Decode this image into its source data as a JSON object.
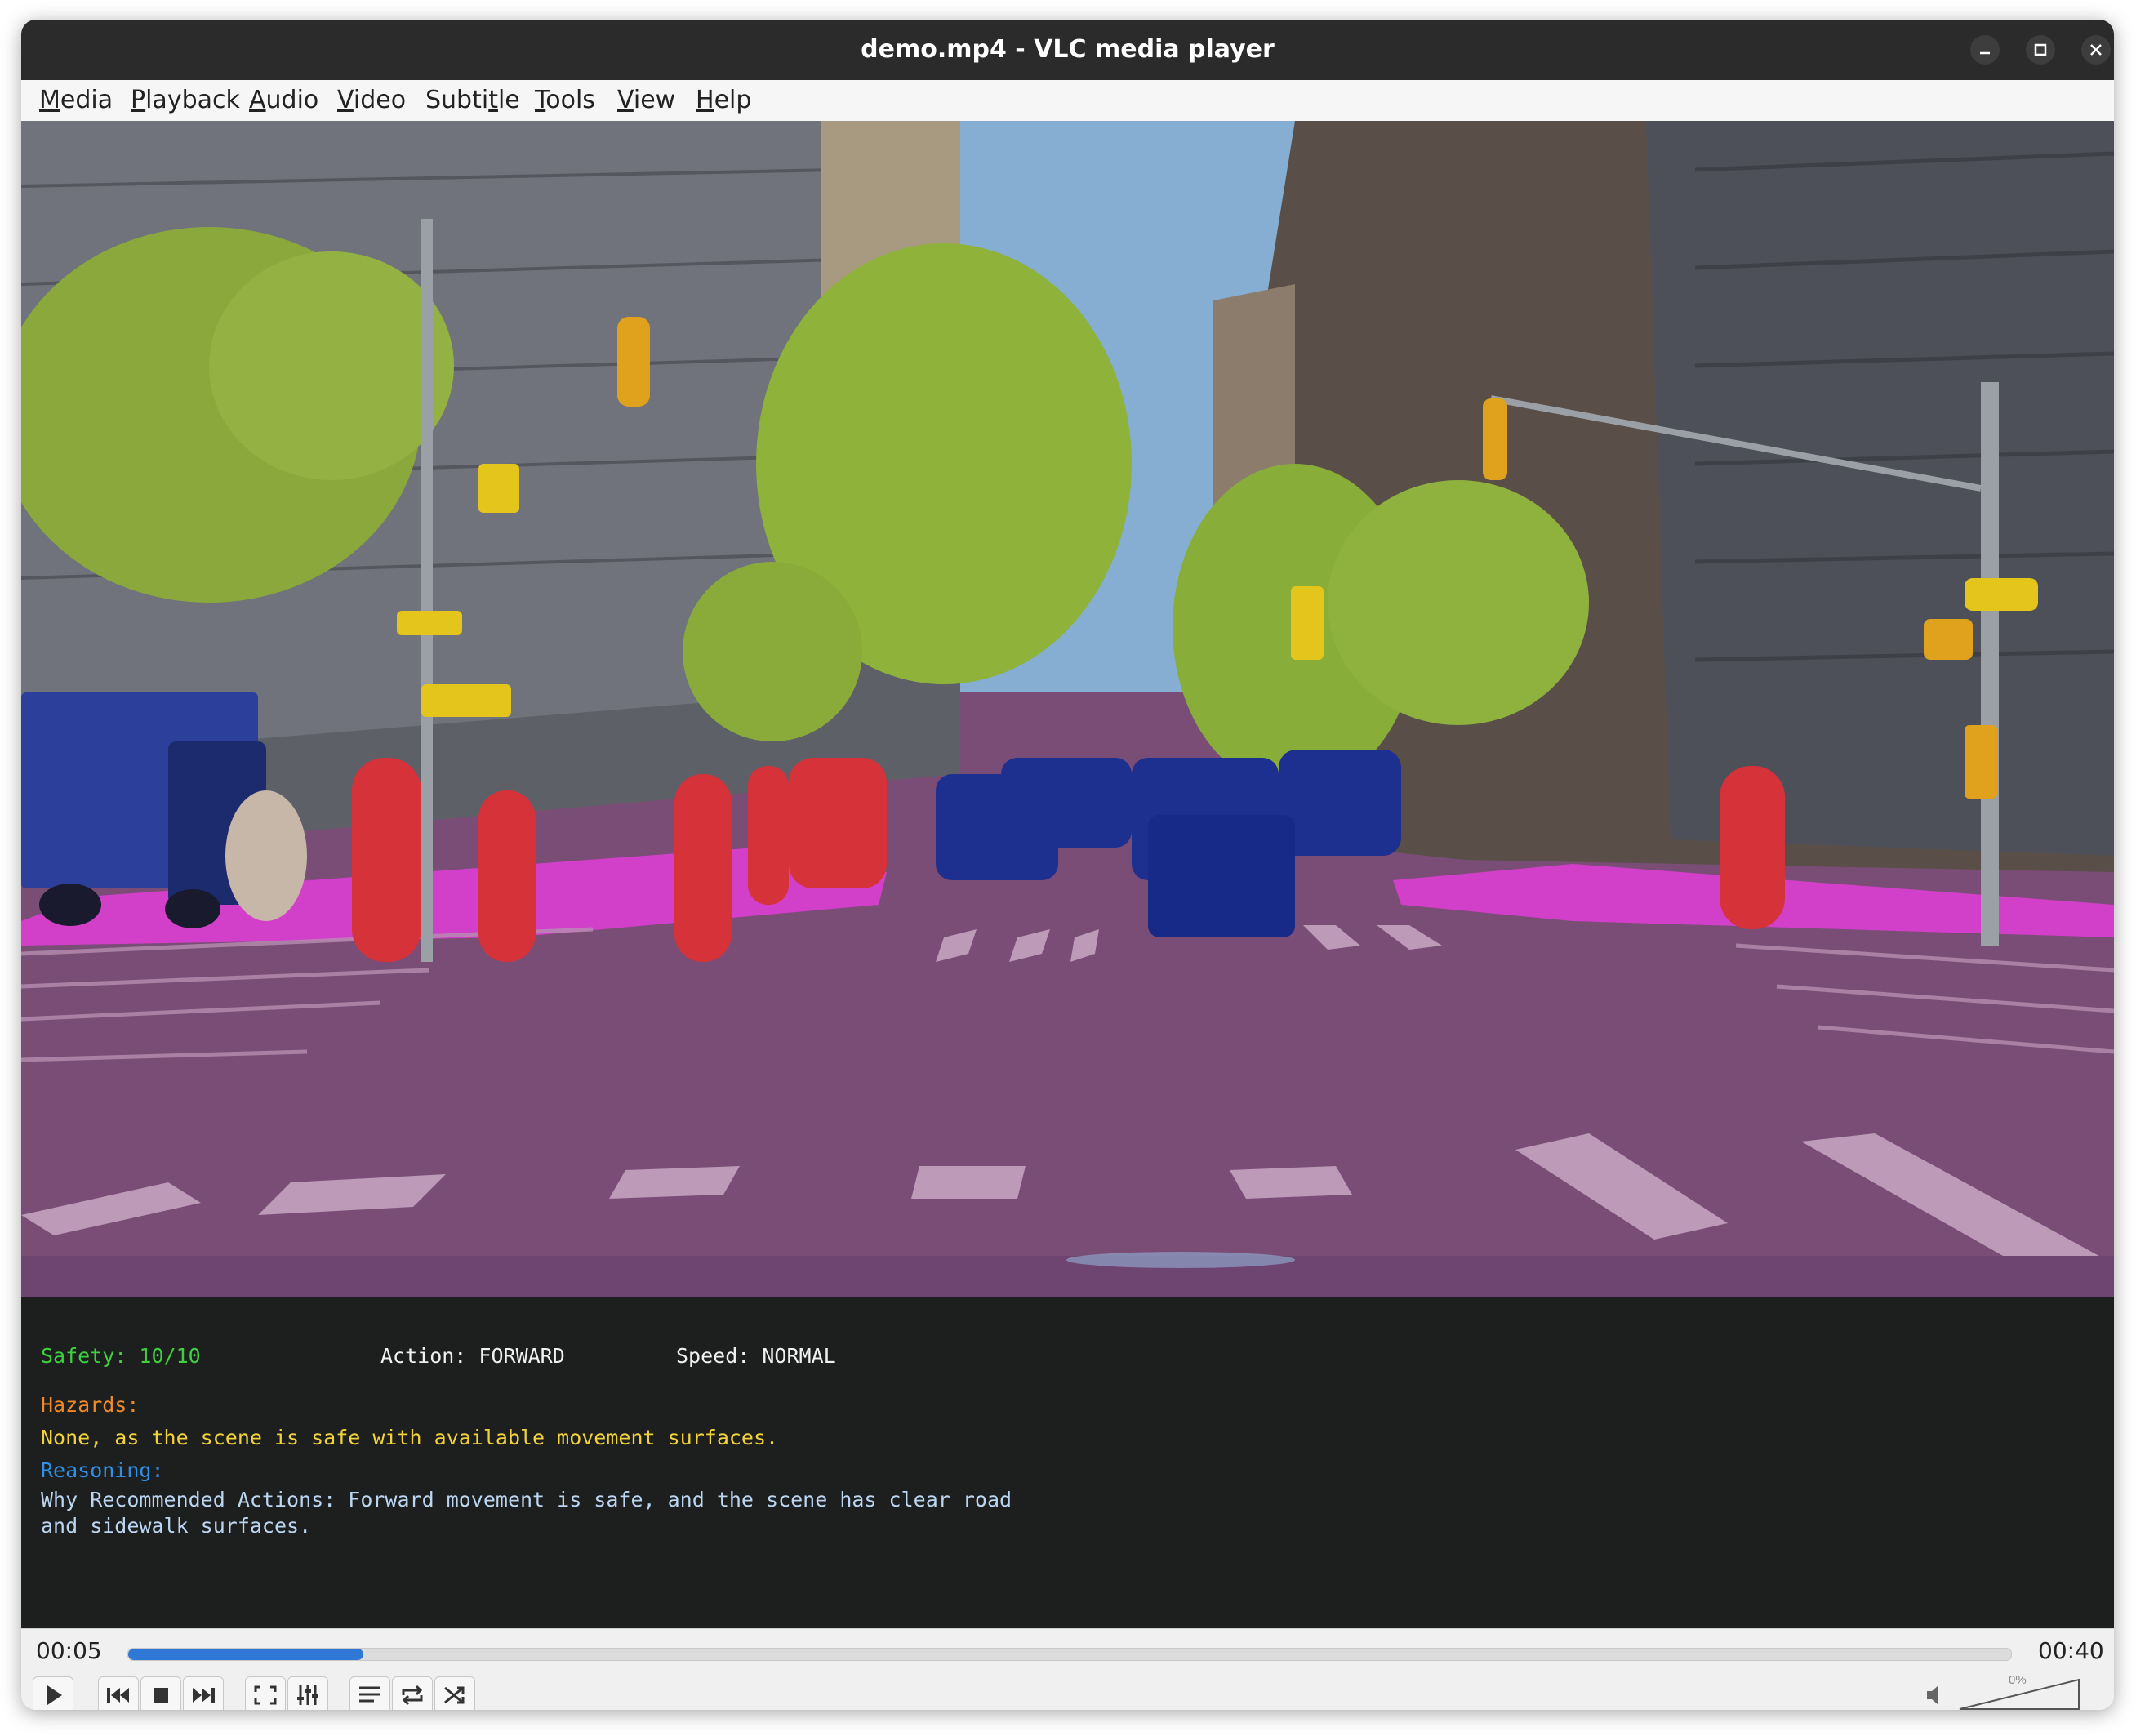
{
  "window": {
    "title": "demo.mp4 - VLC media player"
  },
  "menu": [
    {
      "label": "Media",
      "underline": "M",
      "rest": "edia"
    },
    {
      "label": "Playback",
      "underline": "P",
      "rest": "layback"
    },
    {
      "label": "Audio",
      "underline": "A",
      "rest": "udio"
    },
    {
      "label": "Video",
      "underline": "V",
      "rest": "ideo"
    },
    {
      "label": "Subtitle",
      "pre": "Subti",
      "underline": "t",
      "rest": "le"
    },
    {
      "label": "Tools",
      "underline": "T",
      "rest": "ools"
    },
    {
      "label": "View",
      "underline": "V",
      "rest": "iew"
    },
    {
      "label": "Help",
      "underline": "H",
      "rest": "elp"
    }
  ],
  "overlay": {
    "safety": "Safety: 10/10",
    "action": "Action: FORWARD",
    "speed": "Speed: NORMAL",
    "hazards_label": "Hazards:",
    "hazards_text": "None, as the scene is safe with available movement surfaces.",
    "reasoning_label": "Reasoning:",
    "reasoning_line1": "Why Recommended Actions: Forward movement is safe, and the scene has clear road",
    "reasoning_line2": "and sidewalk surfaces.",
    "colors": {
      "safety": "#3fcf3f",
      "hazards_label": "#f08a2a",
      "hazards_text": "#f2d23c",
      "reasoning_label": "#2f8fe8",
      "reasoning_text": "#bcd6f2",
      "neutral": "#f0f0f0"
    }
  },
  "player": {
    "elapsed": "00:05",
    "total": "00:40",
    "progress_fraction": 0.125,
    "volume_label": "0%",
    "accent": "#2f78d6"
  },
  "icons": [
    "minimize-icon",
    "maximize-icon",
    "close-icon",
    "play-icon",
    "previous-icon",
    "stop-icon",
    "next-icon",
    "fullscreen-icon",
    "equalizer-icon",
    "playlist-icon",
    "loop-icon",
    "shuffle-icon",
    "speaker-icon"
  ]
}
